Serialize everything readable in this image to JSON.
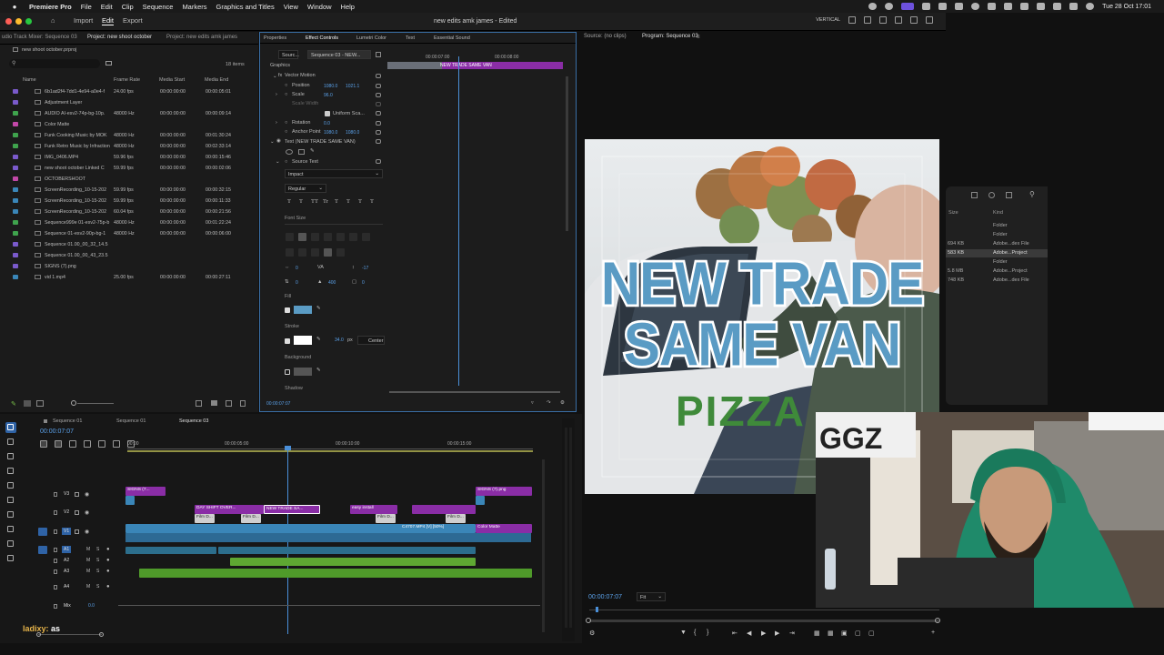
{
  "menubar": {
    "app": "Premiere Pro",
    "items": [
      "File",
      "Edit",
      "Clip",
      "Sequence",
      "Markers",
      "Graphics and Titles",
      "View",
      "Window",
      "Help"
    ],
    "datetime": "Tue 28 Oct  17:01"
  },
  "titlebar": {
    "nav": [
      "Import",
      "Edit",
      "Export"
    ],
    "active_nav": "Edit",
    "document": "new edits amk james  - Edited",
    "layout": "VERTICAL"
  },
  "project": {
    "tabs": [
      "udio Track Mixer: Sequence 03",
      "Project: new shoot october",
      "Project: new edits amk james"
    ],
    "file": "new shoot october.prproj",
    "count": "18 items",
    "columns": [
      "Name",
      "Frame Rate",
      "Media Start",
      "Media End"
    ],
    "rows": [
      {
        "name": "6b1ad2f4-7dd1-4e94-a0e4-f",
        "rate": "24.00 fps",
        "start": "00:00:00:00",
        "end": "00:00:05:01",
        "color": "#7a5acb"
      },
      {
        "name": "Adjustment Layer",
        "rate": "",
        "start": "",
        "end": "",
        "color": "#7a5acb"
      },
      {
        "name": "AUDIO AI-esv2-74p-bg-10p.",
        "rate": "48000 Hz",
        "start": "00:00:00:00",
        "end": "00:00:09:14",
        "color": "#3fa34d"
      },
      {
        "name": "Color Matte",
        "rate": "",
        "start": "",
        "end": "",
        "color": "#c248a8"
      },
      {
        "name": "Funk Cooking Music by MOK",
        "rate": "48000 Hz",
        "start": "00:00:00:00",
        "end": "00:01:30:24",
        "color": "#3fa34d"
      },
      {
        "name": "Funk Retro Music by Infraction",
        "rate": "48000 Hz",
        "start": "00:00:00:00",
        "end": "00:02:33:14",
        "color": "#3fa34d"
      },
      {
        "name": "IMG_0406.MP4",
        "rate": "59.96 fps",
        "start": "00:00:00:00",
        "end": "00:00:15:46",
        "color": "#7a5acb"
      },
      {
        "name": "new shoot october Linked C",
        "rate": "59.99 fps",
        "start": "00:00:00:00",
        "end": "00:00:02:06",
        "color": "#7a5acb"
      },
      {
        "name": "OCTOBERSHOOT",
        "rate": "",
        "start": "",
        "end": "",
        "color": "#c248a8"
      },
      {
        "name": "ScreenRecording_10-15-202",
        "rate": "59.99 fps",
        "start": "00:00:00:00",
        "end": "00:00:32:15",
        "color": "#3a86b8"
      },
      {
        "name": "ScreenRecording_10-15-202",
        "rate": "59.99 fps",
        "start": "00:00:00:00",
        "end": "00:00:11:33",
        "color": "#3a86b8"
      },
      {
        "name": "ScreenRecording_10-15-202",
        "rate": "60.04 fps",
        "start": "00:00:00:00",
        "end": "00:00:21:56",
        "color": "#3a86b8"
      },
      {
        "name": "Sequence999e 01-esv2-75p-b",
        "rate": "48000 Hz",
        "start": "00:00:00:00",
        "end": "00:01:22:24",
        "color": "#3fa34d"
      },
      {
        "name": "Sequence 01-esv2-90p-bg-1",
        "rate": "48000 Hz",
        "start": "00:00:00:00",
        "end": "00:00:06:00",
        "color": "#3fa34d"
      },
      {
        "name": "Sequence 01.00_00_32_14.5",
        "rate": "",
        "start": "",
        "end": "",
        "color": "#7a5acb"
      },
      {
        "name": "Sequence 01.00_00_43_23.5",
        "rate": "",
        "start": "",
        "end": "",
        "color": "#7a5acb"
      },
      {
        "name": "SIGNS (7).png",
        "rate": "",
        "start": "",
        "end": "",
        "color": "#7a5acb"
      },
      {
        "name": "vid 1.mp4",
        "rate": "25.00 fps",
        "start": "00:00:00:00",
        "end": "00:00:27:11",
        "color": "#3a86b8"
      }
    ]
  },
  "effects": {
    "tabs": [
      "Properties",
      "Effect Controls",
      "Lumetri Color",
      "Text",
      "Essential Sound"
    ],
    "active_tab": "Effect Controls",
    "source_dd": "Sourc...",
    "seq_dd": "Sequence 03 - NEW...",
    "ruler": [
      "00:00:07:00",
      "00:00:08:00"
    ],
    "clip_label": "NEW TRADE SAME VAN",
    "graphics": "Graphics",
    "vector_motion": "Vector Motion",
    "position_label": "Position",
    "position_x": "1080.0",
    "position_y": "1021.1",
    "scale_label": "Scale",
    "scale_val": "96.0",
    "scale_width_label": "Scale Width",
    "uniform_scale": "Uniform Sca...",
    "rotation_label": "Rotation",
    "rotation_val": "0.0",
    "anchor_label": "Anchor Point",
    "anchor_x": "1080.0",
    "anchor_y": "1080.0",
    "text_layer": "Text (NEW TRADE SAME VAN)",
    "source_text": "Source Text",
    "font": "Impact",
    "weight": "Regular",
    "style_glyphs": [
      "T",
      "T",
      "TT",
      "Tr",
      "T",
      "T",
      "T",
      "T"
    ],
    "font_size": "Font Size",
    "tracking_val": "0",
    "kerning_val": "-17",
    "leading_val": "0",
    "baseline_val": "400",
    "tsume_val": "0",
    "fill": "Fill",
    "fill_color": "#5a9bc4",
    "stroke": "Stroke",
    "stroke_width": "34.0",
    "stroke_unit": "px",
    "stroke_pos": "Center",
    "background": "Background",
    "shadow": "Shadow",
    "timecode": "00:00:07:07"
  },
  "monitor": {
    "source_tab": "Source: (no clips)",
    "program_tab": "Program: Sequence 03",
    "title_line1": "NEW TRADE",
    "title_line2": "SAME VAN",
    "van_text": "PIZZA",
    "timecode": "00:00:07:07",
    "fit": "Fit",
    "sign_text": "GGZ"
  },
  "finder": {
    "kind_header": "Kind",
    "size_header": "Size",
    "rows": [
      {
        "size": "",
        "kind": "Folder",
        "selected": false
      },
      {
        "size": "",
        "kind": "Folder",
        "selected": false
      },
      {
        "size": "694 KB",
        "kind": "Adobe...dex File",
        "selected": false
      },
      {
        "size": "583 KB",
        "kind": "Adobe...Project",
        "selected": true
      },
      {
        "size": "",
        "kind": "Folder",
        "selected": false
      },
      {
        "size": "5.8 MB",
        "kind": "Adobe...Project",
        "selected": false
      },
      {
        "size": "748 KB",
        "kind": "Adobe...dex File",
        "selected": false
      }
    ]
  },
  "timeline": {
    "tabs": [
      "Sequence 01",
      "Sequence 01",
      "Sequence 03"
    ],
    "active_tab": "Sequence 03",
    "timecode": "00:00:07:07",
    "ruler": [
      "00:00",
      "00:00:05:00",
      "00:00:10:00",
      "00:00:15:00"
    ],
    "tracks": [
      "V3",
      "V2",
      "V1",
      "A1",
      "A2",
      "A3",
      "A4",
      "Mix"
    ],
    "mix_val": "0.0",
    "clips": {
      "signs1": "SIGNS (7...",
      "dayshift": "DAY SHIFT OVER...",
      "newtrade": "NEW TRADE SA...",
      "easyinstall": "easy install",
      "signs2": "SIGNS (7).png",
      "filmd": "Film D...",
      "c4707": "C4707.MP4 [V] [50%]",
      "colormatte": "Color Matte"
    }
  },
  "chat": {
    "user": "ladixy:",
    "message": "as"
  }
}
